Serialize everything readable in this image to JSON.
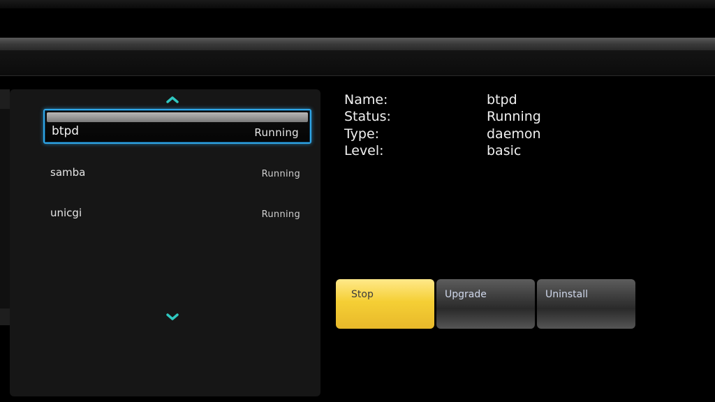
{
  "service_list": {
    "items": [
      {
        "name": "btpd",
        "status": "Running",
        "selected": true
      },
      {
        "name": "samba",
        "status": "Running",
        "selected": false
      },
      {
        "name": "unicgi",
        "status": "Running",
        "selected": false
      }
    ],
    "scroll_up_icon": "chevron-up-icon",
    "scroll_down_icon": "chevron-down-icon"
  },
  "details": {
    "name_label": "Name:",
    "name_value": "btpd",
    "status_label": "Status:",
    "status_value": "Running",
    "type_label": "Type:",
    "type_value": "daemon",
    "level_label": "Level:",
    "level_value": "basic"
  },
  "actions": {
    "stop_label": "Stop",
    "upgrade_label": "Upgrade",
    "uninstall_label": "Uninstall"
  },
  "colors": {
    "selection_border": "#2fa6e8",
    "accent_arrow": "#2fc8c0",
    "active_button": "#f5cf35"
  }
}
